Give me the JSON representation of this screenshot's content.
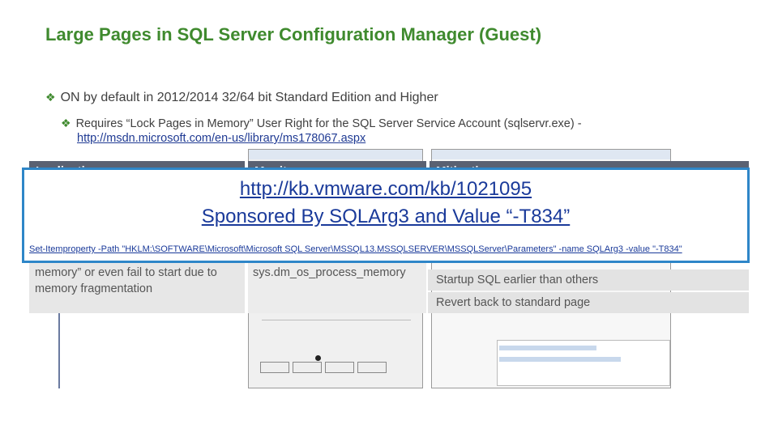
{
  "title": "Large Pages in SQL Server Configuration Manager (Guest)",
  "bullets": {
    "main": "ON by default in 2012/2014 32/64 bit Standard Edition and Higher",
    "sub": "Requires “Lock Pages in Memory” User Right for the SQL Server Service Account (sqlservr.exe) -",
    "sub_link": "http://msdn.microsoft.com/en-us/library/ms178067.aspx"
  },
  "table": {
    "headers": [
      "Implication",
      "Monitor",
      "Mitigation"
    ],
    "implication_text": "memory” or even fail to start due to memory fragmentation",
    "monitor_text": "sys.dm_os_process_memory",
    "mitigation_rows": [
      "Startup SQL earlier than others",
      "Revert back to standard page"
    ]
  },
  "overlay": {
    "url": "http://kb.vmware.com/kb/1021095",
    "sponsor": "Sponsored By SQLArg3 and Value “-T834”",
    "command": "Set-Itemproperty -Path \"HKLM:\\SOFTWARE\\Microsoft\\Microsoft SQL Server\\MSSQL13.MSSQLSERVER\\MSSQLServer\\Parameters\" -name SQLArg3 -value \"-T834\""
  },
  "colors": {
    "title": "#3f8a2e",
    "overlay_border": "#2e86c8",
    "header_bg": "#5a6172"
  }
}
